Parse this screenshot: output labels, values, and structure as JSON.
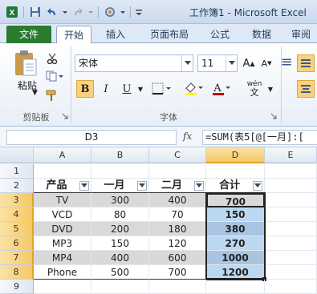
{
  "window": {
    "title": "工作簿1 - Microsoft Excel"
  },
  "ribbon": {
    "tabs": [
      "文件",
      "开始",
      "插入",
      "页面布局",
      "公式",
      "数据",
      "审阅"
    ],
    "active_tab": "开始",
    "clipboard": {
      "paste_label": "粘贴",
      "group_label": "剪贴板"
    },
    "font": {
      "name": "宋体",
      "size": "11",
      "group_label": "字体",
      "bold": "B",
      "italic": "I",
      "underline": "U",
      "wen": "wén"
    }
  },
  "formula_bar": {
    "name_box": "D3",
    "fx": "fx",
    "formula": "=SUM(表5[@[一月]:["
  },
  "sheet": {
    "columns": [
      "A",
      "B",
      "C",
      "D",
      "E"
    ],
    "rows": [
      "1",
      "2",
      "3",
      "4",
      "5",
      "6",
      "7",
      "8",
      "9"
    ],
    "table_headers": [
      "产品",
      "一月",
      "二月",
      "合计"
    ],
    "table_rows": [
      [
        "TV",
        "300",
        "400",
        "700"
      ],
      [
        "VCD",
        "80",
        "70",
        "150"
      ],
      [
        "DVD",
        "200",
        "180",
        "380"
      ],
      [
        "MP3",
        "150",
        "120",
        "270"
      ],
      [
        "MP4",
        "400",
        "600",
        "1000"
      ],
      [
        "Phone",
        "500",
        "700",
        "1200"
      ]
    ]
  },
  "colors": {
    "file_tab": "#2a7a2f",
    "selection": "#f6c766",
    "table_band": "#d9d9d9",
    "total_col": "#bcd7f0"
  }
}
